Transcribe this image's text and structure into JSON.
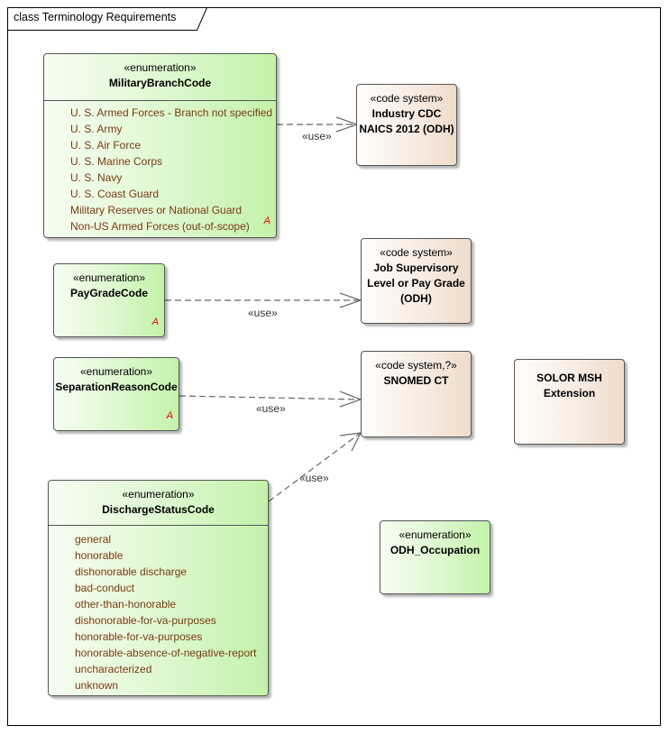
{
  "diagram": {
    "frame_title": "class Terminology Requirements",
    "colors": {
      "enumeration_fill": "#c3f2aa",
      "code_system_fill": "#eedccc",
      "attribute_text": "#7a3a14",
      "abstract_marker": "#ee0000",
      "connector": "#666666"
    },
    "nodes": {
      "military_branch": {
        "stereotype": "«enumeration»",
        "name": "MilitaryBranchCode",
        "attributes": [
          "U. S. Armed Forces - Branch not specified",
          "U. S.  Army",
          "U. S. Air Force",
          "U. S. Marine Corps",
          "U. S. Navy",
          "U. S. Coast Guard",
          "Military Reserves or National Guard",
          "Non-US Armed Forces (out-of-scope)"
        ],
        "abstract_marker": "A"
      },
      "pay_grade": {
        "stereotype": "«enumeration»",
        "name": "PayGradeCode",
        "abstract_marker": "A"
      },
      "separation_reason": {
        "stereotype": "«enumeration»",
        "name": "SeparationReasonCode",
        "abstract_marker": "A"
      },
      "discharge_status": {
        "stereotype": "«enumeration»",
        "name": "DischargeStatusCode",
        "attributes": [
          "general",
          "honorable",
          "dishonorable discharge",
          "bad-conduct",
          "other-than-honorable",
          "dishonorable-for-va-purposes",
          "honorable-for-va-purposes",
          "honorable-absence-of-negative-report",
          "uncharacterized",
          "unknown"
        ]
      },
      "industry_cdc": {
        "stereotype": "«code system»",
        "name_line1": "Industry CDC",
        "name_line2": "NAICS 2012 (ODH)"
      },
      "job_supervisory": {
        "stereotype": "«code system»",
        "name_line1": "Job Supervisory",
        "name_line2": "Level or Pay Grade",
        "name_line3": "(ODH)"
      },
      "snomed": {
        "stereotype": "«code system,?»",
        "name": "SNOMED CT"
      },
      "solor": {
        "name_line1": "SOLOR MSH",
        "name_line2": "Extension"
      },
      "odh_occupation": {
        "stereotype": "«enumeration»",
        "name": "ODH_Occupation"
      }
    },
    "connectors": [
      {
        "from": "MilitaryBranchCode",
        "to": "Industry CDC NAICS 2012 (ODH)",
        "label": "«use»"
      },
      {
        "from": "PayGradeCode",
        "to": "Job Supervisory Level or Pay Grade (ODH)",
        "label": "«use»"
      },
      {
        "from": "SeparationReasonCode",
        "to": "SNOMED CT",
        "label": "«use»"
      },
      {
        "from": "DischargeStatusCode",
        "to": "SNOMED CT",
        "label": "«use»"
      }
    ]
  }
}
